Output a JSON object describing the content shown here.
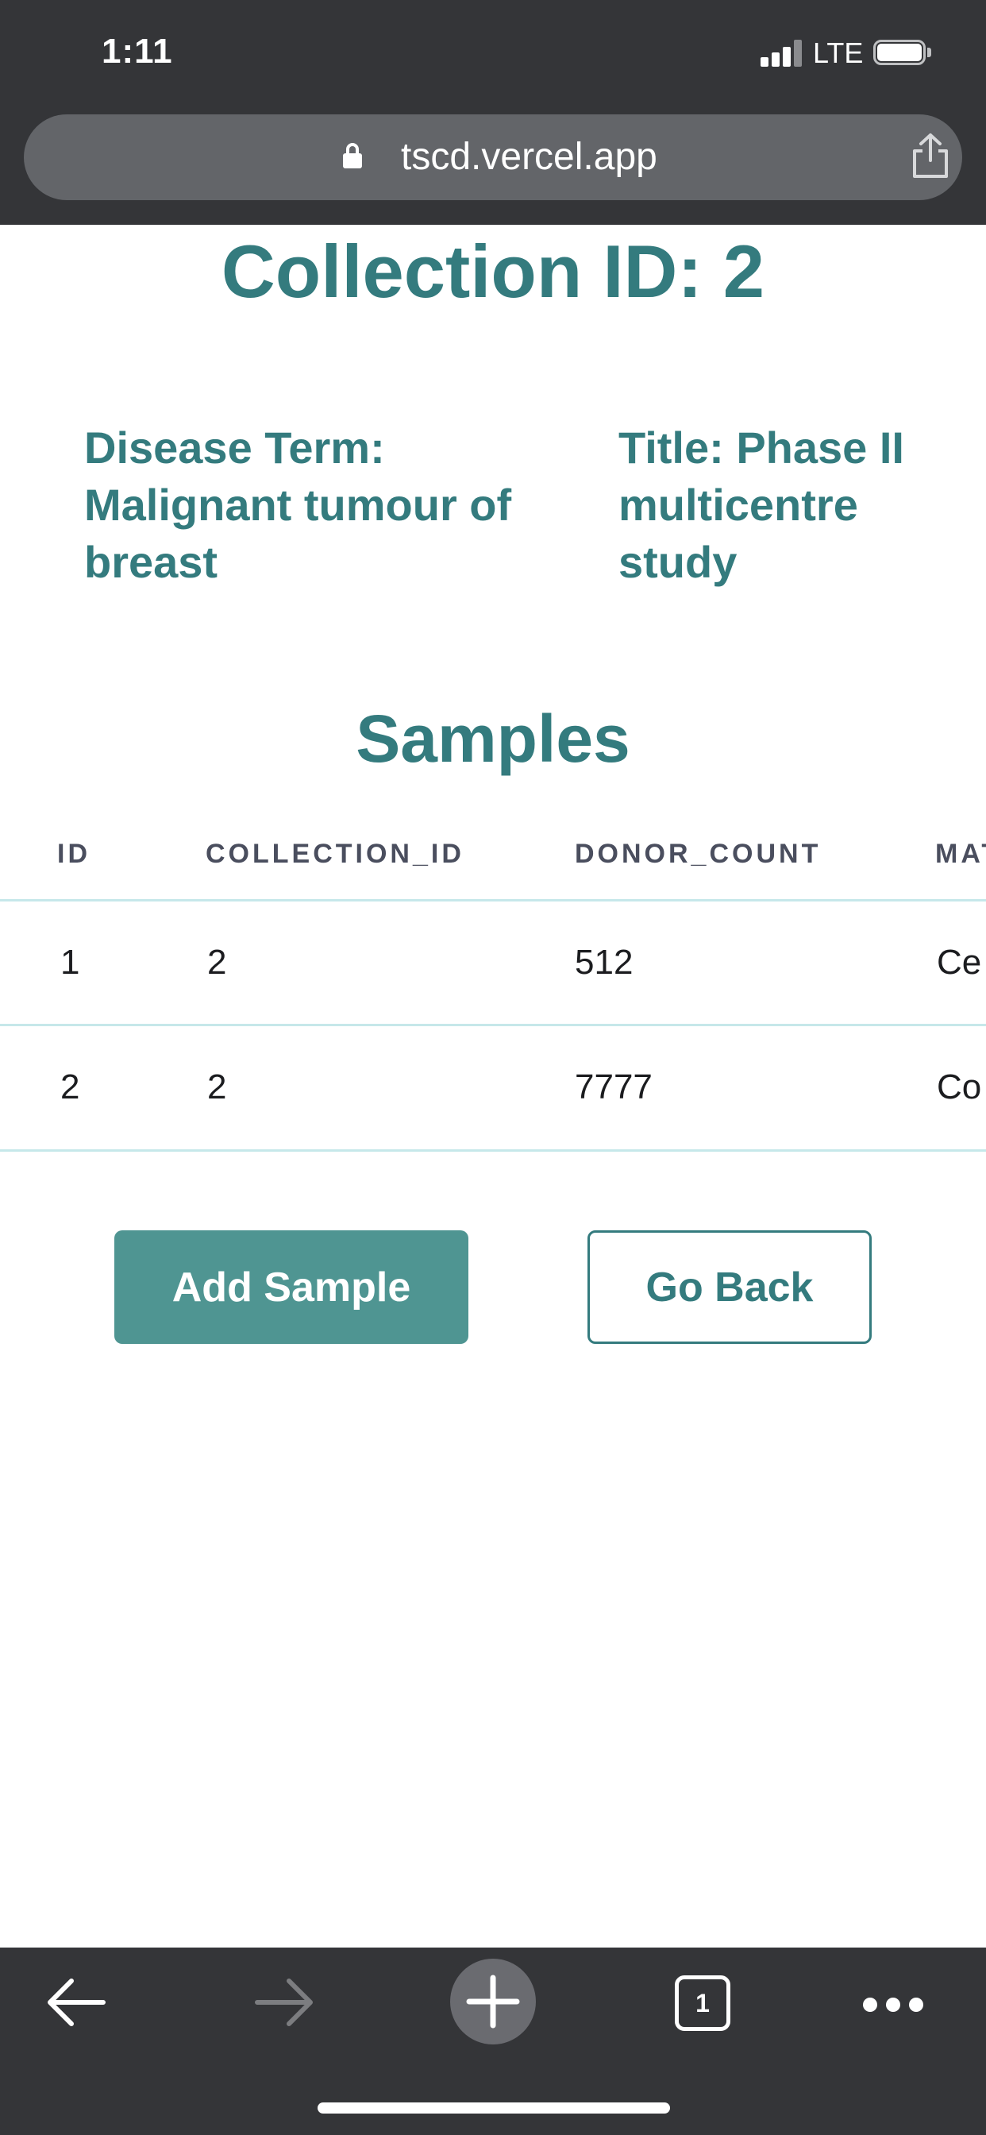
{
  "status_bar": {
    "time": "1:11",
    "network": "LTE"
  },
  "browser": {
    "url": "tscd.vercel.app"
  },
  "page": {
    "title": "Collection ID: 2",
    "disease_term": "Disease Term: Malignant tumour of breast",
    "collection_title": "Title: Phase II multicentre study",
    "samples_heading": "Samples"
  },
  "table": {
    "headers": [
      "ID",
      "COLLECTION_ID",
      "DONOR_COUNT",
      "MAT"
    ],
    "rows": [
      [
        "1",
        "2",
        "512",
        "Ce"
      ],
      [
        "2",
        "2",
        "7777",
        "Co"
      ]
    ]
  },
  "buttons": {
    "add_sample": "Add Sample",
    "go_back": "Go Back"
  },
  "toolbar": {
    "tab_count": "1"
  },
  "colors": {
    "accent": "#347b7e",
    "button_fill": "#4f9592",
    "chrome": "#343538",
    "row_divider": "#c6e8ea"
  }
}
